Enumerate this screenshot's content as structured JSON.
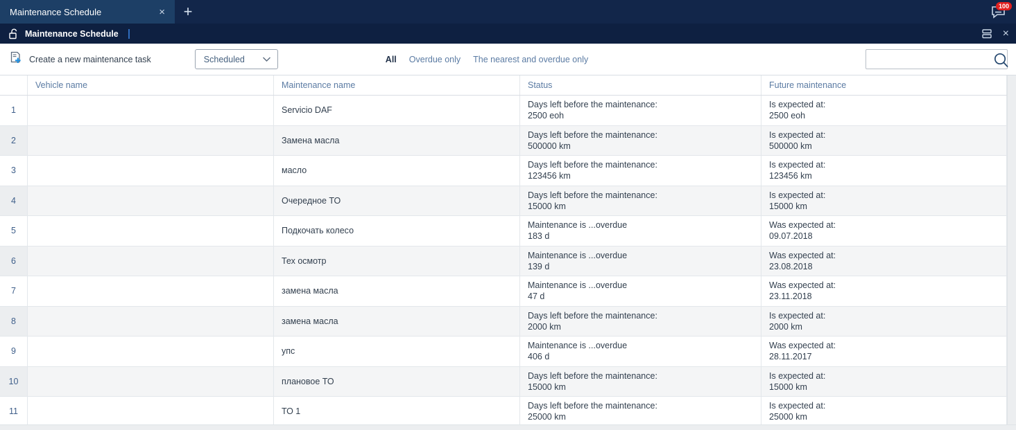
{
  "window": {
    "tab_title": "Maintenance Schedule",
    "tab_close_glyph": "×",
    "new_tab_glyph": "+",
    "message_badge": "100"
  },
  "breadcrumb": {
    "title": "Maintenance Schedule",
    "close_glyph": "×"
  },
  "toolbar": {
    "create_task_label": "Create a new maintenance task",
    "schedule_select_value": "Scheduled",
    "filters": [
      {
        "label": "All",
        "active": true
      },
      {
        "label": "Overdue only",
        "active": false
      },
      {
        "label": "The nearest and overdue only",
        "active": false
      }
    ],
    "search_value": "",
    "search_placeholder": ""
  },
  "table": {
    "columns": [
      "",
      "Vehicle name",
      "Maintenance name",
      "Status",
      "Future maintenance"
    ],
    "rows": [
      {
        "num": "1",
        "vehicle": "",
        "maintenance": "Servicio DAF",
        "status_label": "Days left before the maintenance:",
        "status_value": "2500 eoh",
        "future_label": "Is expected at:",
        "future_value": "2500 eoh"
      },
      {
        "num": "2",
        "vehicle": "",
        "maintenance": "Замена масла",
        "status_label": "Days left before the maintenance:",
        "status_value": "500000 km",
        "future_label": "Is expected at:",
        "future_value": "500000 km"
      },
      {
        "num": "3",
        "vehicle": "",
        "maintenance": "масло",
        "status_label": "Days left before the maintenance:",
        "status_value": "123456 km",
        "future_label": "Is expected at:",
        "future_value": "123456 km"
      },
      {
        "num": "4",
        "vehicle": "",
        "maintenance": "Очередное ТО",
        "status_label": "Days left before the maintenance:",
        "status_value": "15000 km",
        "future_label": "Is expected at:",
        "future_value": "15000 km"
      },
      {
        "num": "5",
        "vehicle": "",
        "maintenance": "Подкочать колесо",
        "status_label": "Maintenance is ...overdue",
        "status_value": "183 d",
        "future_label": "Was expected at:",
        "future_value": "09.07.2018"
      },
      {
        "num": "6",
        "vehicle": "",
        "maintenance": "Тех осмотр",
        "status_label": "Maintenance is ...overdue",
        "status_value": "139 d",
        "future_label": "Was expected at:",
        "future_value": "23.08.2018"
      },
      {
        "num": "7",
        "vehicle": "",
        "maintenance": "замена масла",
        "status_label": "Maintenance is ...overdue",
        "status_value": "47 d",
        "future_label": "Was expected at:",
        "future_value": "23.11.2018"
      },
      {
        "num": "8",
        "vehicle": "",
        "maintenance": "замена масла",
        "status_label": "Days left before the maintenance:",
        "status_value": "2000 km",
        "future_label": "Is expected at:",
        "future_value": "2000 km"
      },
      {
        "num": "9",
        "vehicle": "",
        "maintenance": "упс",
        "status_label": "Maintenance is ...overdue",
        "status_value": "406 d",
        "future_label": "Was expected at:",
        "future_value": "28.11.2017"
      },
      {
        "num": "10",
        "vehicle": "",
        "maintenance": "плановое ТО",
        "status_label": "Days left before the maintenance:",
        "status_value": "15000 km",
        "future_label": "Is expected at:",
        "future_value": "15000 km"
      },
      {
        "num": "11",
        "vehicle": "",
        "maintenance": "ТО 1",
        "status_label": "Days left before the maintenance:",
        "status_value": "25000 km",
        "future_label": "Is expected at:",
        "future_value": "25000 km"
      }
    ]
  },
  "colors": {
    "tabbar_bg": "#12264a",
    "tab_active_bg": "#1d3f66",
    "crumbbar_bg": "#0e2041",
    "accent_link": "#5b7ba3",
    "badge_red": "#e02020",
    "row_alt_bg": "#f4f5f6"
  }
}
